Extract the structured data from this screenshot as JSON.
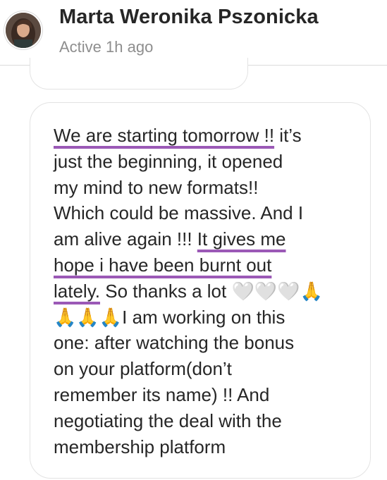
{
  "header": {
    "contact_name": "Marta Weronika Pszonicka",
    "presence": "Active 1h ago"
  },
  "message": {
    "line1_hl": "We are starting tomorrow !!",
    "line1_rest": " it’s",
    "line2": "just the beginning, it opened",
    "line3": "my mind to new formats!!",
    "line4": "Which could be massive. And I",
    "line5_plain": "am alive again !!! ",
    "line5_hl": "It gives me",
    "line6_hl": "hope i have been burnt out",
    "line7_hl": "lately.",
    "line7_text": " So thanks a lot ",
    "line7_hearts": "🤍🤍🤍",
    "line7_pray": "🙏",
    "line8_pray": "🙏🙏🙏",
    "line8_text": "I am working on this",
    "line9": "one: after watching the bonus",
    "line10": "on your platform(don’t",
    "line11": "remember its name) !! And",
    "line12": "negotiating the deal with the",
    "line13": "membership platform"
  },
  "colors": {
    "highlight_underline": "#9b59b6",
    "text": "#262626",
    "secondary_text": "#8e8e8e",
    "bubble_border": "#e3e3e3"
  },
  "icons": {
    "avatar": "profile-photo"
  }
}
